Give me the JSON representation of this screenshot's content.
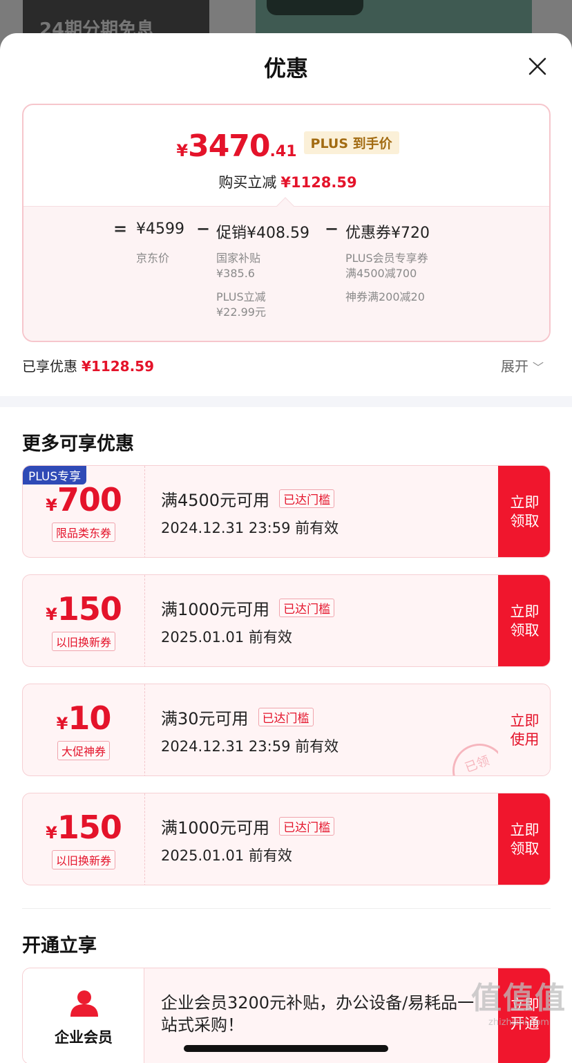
{
  "background": {
    "badge_text": "24期分期免息"
  },
  "sheet": {
    "title": "优惠"
  },
  "price_card": {
    "yen": "¥",
    "price_int": "3470",
    "price_dec": ".41",
    "plus_tag": "PLUS 到手价",
    "save_label": "购买立减",
    "save_amount": "¥1128.59",
    "eq": "=",
    "jd_price": "¥4599",
    "jd_label": "京东价",
    "minus1": "−",
    "promo": "促销¥408.59",
    "promo_items": [
      {
        "name": "国家补贴",
        "value": "¥385.6"
      },
      {
        "name": "PLUS立减",
        "value": "¥22.99元"
      }
    ],
    "minus2": "−",
    "coupon": "优惠券¥720",
    "coupon_items": [
      {
        "name": "PLUS会员专享券",
        "value": "满4500减700"
      },
      {
        "name": "神券满200减20",
        "value": ""
      }
    ]
  },
  "enjoyed": {
    "label": "已享优惠",
    "amount": "¥1128.59",
    "expand": "展开"
  },
  "more_section": {
    "title": "更多可享优惠"
  },
  "coupons": [
    {
      "corner": "PLUS专享",
      "yen": "¥",
      "amount": "700",
      "kind": "限品类东券",
      "condition": "满4500元可用",
      "reached": "已达门槛",
      "valid": "2024.12.31 23:59 前有效",
      "action_line1": "立即",
      "action_line2": "领取"
    },
    {
      "corner": "",
      "yen": "¥",
      "amount": "150",
      "kind": "以旧换新券",
      "condition": "满1000元可用",
      "reached": "已达门槛",
      "valid": "2025.01.01 前有效",
      "action_line1": "立即",
      "action_line2": "领取"
    },
    {
      "corner": "",
      "yen": "¥",
      "amount": "10",
      "kind": "大促神券",
      "condition": "满30元可用",
      "reached": "已达门槛",
      "valid": "2024.12.31 23:59 前有效",
      "action_line1": "立即",
      "action_line2": "使用",
      "stamp": "已领"
    },
    {
      "corner": "",
      "yen": "¥",
      "amount": "150",
      "kind": "以旧换新券",
      "condition": "满1000元可用",
      "reached": "已达门槛",
      "valid": "2025.01.01 前有效",
      "action_line1": "立即",
      "action_line2": "领取"
    }
  ],
  "open_section": {
    "title": "开通立享"
  },
  "member": {
    "label": "企业会员",
    "desc": "企业会员3200元补贴，办公设备/易耗品一站式采购！",
    "action_line1": "立即",
    "action_line2": "开通"
  },
  "watermark": {
    "big": "值值值",
    "small": "zhizhizhi.com"
  },
  "colors": {
    "accent": "#e4132a",
    "button": "#f0162d",
    "plus_blue": "#2f4ab6",
    "plus_gold": "#a26b12"
  },
  "icons": [
    "close-icon",
    "chevron-down-icon",
    "person-icon"
  ]
}
